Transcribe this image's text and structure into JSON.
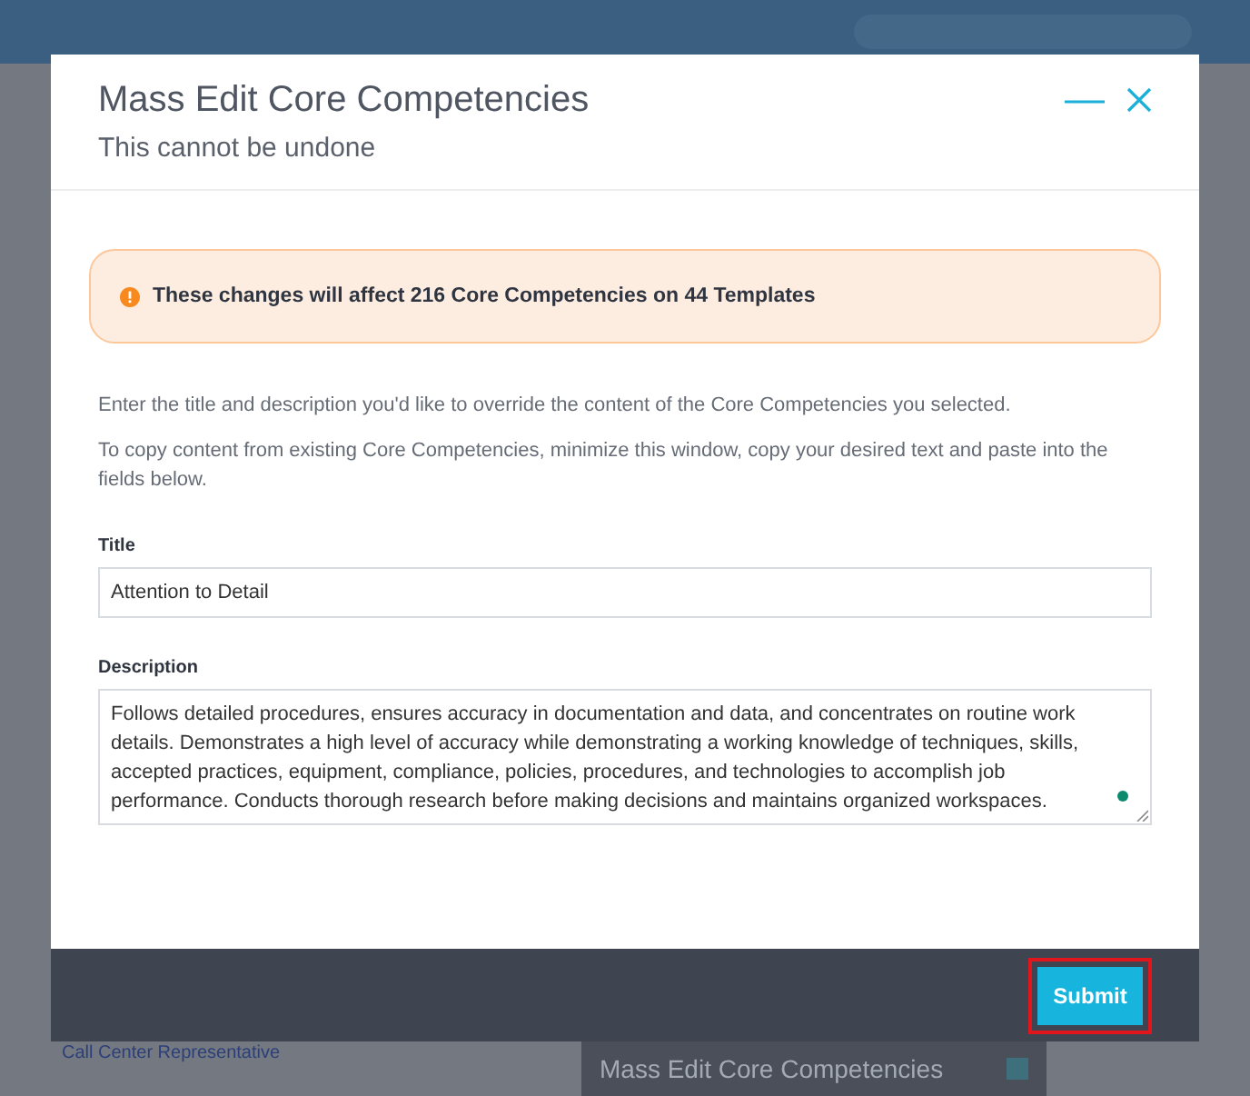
{
  "background": {
    "link": "Call Center Representative",
    "minimized_window": {
      "title": "Mass Edit Core Competencies"
    }
  },
  "dialog": {
    "title": "Mass Edit Core Competencies",
    "subtitle": "This cannot be undone",
    "warning": "These changes will affect 216 Core Competencies on 44 Templates",
    "paragraphs": [
      "Enter the title and description you'd like to override the content of the Core Competencies you selected.",
      "To copy content from existing Core Competencies, minimize this window, copy your desired text and paste into the fields below."
    ],
    "fields": [
      {
        "kind": "input",
        "label": "Title",
        "value": "Attention to Detail"
      },
      {
        "kind": "textarea",
        "label": "Description",
        "value": "Follows detailed procedures, ensures accuracy in documentation and data, and concentrates on routine work details. Demonstrates a high level of accuracy while demonstrating a working knowledge of techniques, skills, accepted practices, equipment, compliance, policies, procedures, and technologies to accomplish job performance. Conducts thorough research before making decisions and maintains organized workspaces."
      }
    ],
    "submit": {
      "label": "Submit",
      "highlighted": true
    }
  }
}
